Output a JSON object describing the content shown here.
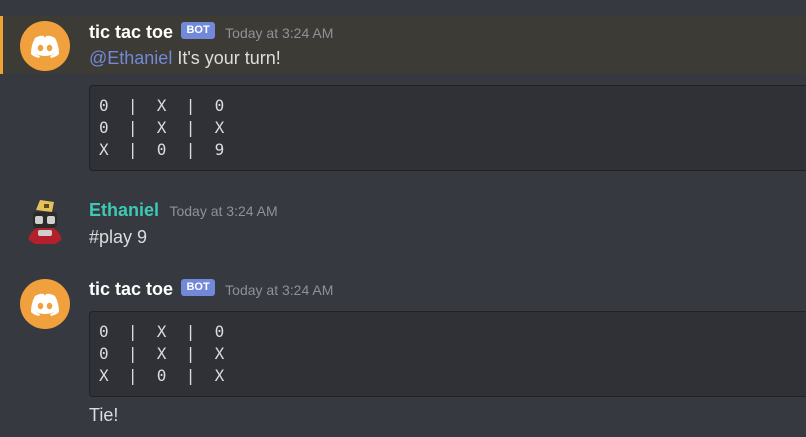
{
  "messages": [
    {
      "author": "tic tac toe",
      "bot_tag": "BOT",
      "timestamp": "Today at 3:24 AM",
      "mention": "@Ethaniel",
      "text": " It's your turn!",
      "board": [
        "0  |  X  |  0",
        "0  |  X  |  X",
        "X  |  0  |  9"
      ]
    },
    {
      "author": "Ethaniel",
      "timestamp": "Today at 3:24 AM",
      "text": "#play 9"
    },
    {
      "author": "tic tac toe",
      "bot_tag": "BOT",
      "timestamp": "Today at 3:24 AM",
      "board": [
        "0  |  X  |  0",
        "0  |  X  |  X",
        "X  |  0  |  X"
      ],
      "text": "Tie!"
    }
  ],
  "colors": {
    "background": "#36393f",
    "mention_highlight": "#3d3b35",
    "mention_bar": "#f0a232",
    "bot_avatar": "#f0a13d",
    "bot_tag": "#7289da",
    "user_name": "#3fc9b3",
    "code_block": "#2f3136"
  },
  "icons": {
    "bot_avatar": "discord-logo-icon",
    "user_avatar": "user-avatar-icon"
  }
}
